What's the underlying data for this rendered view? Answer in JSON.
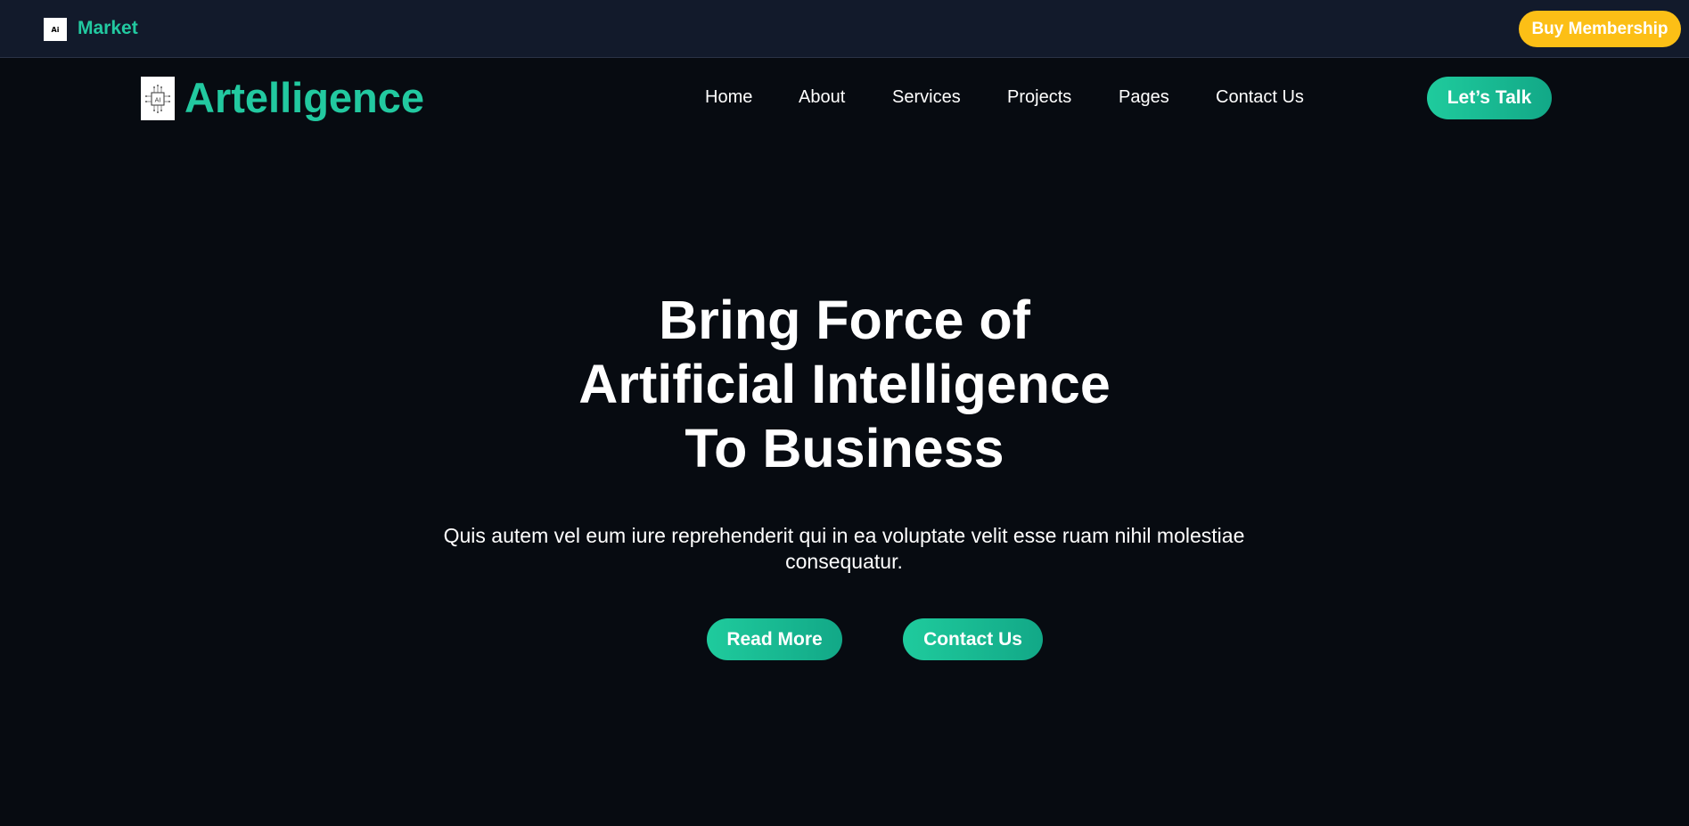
{
  "topbar": {
    "logo_text": "Ai",
    "market_label": "Market",
    "buy_label": "Buy Membership"
  },
  "brand": {
    "icon": "ai-chip-icon",
    "name": "Artelligence"
  },
  "nav": {
    "items": [
      {
        "label": "Home"
      },
      {
        "label": "About"
      },
      {
        "label": "Services"
      },
      {
        "label": "Projects"
      },
      {
        "label": "Pages"
      },
      {
        "label": "Contact Us"
      }
    ],
    "cta_label": "Let’s Talk"
  },
  "hero": {
    "title_lines": [
      "Bring Force of",
      "Artificial Intelligence",
      "To Business"
    ],
    "subtitle": "Quis autem vel eum iure reprehenderit qui in ea voluptate velit esse ruam nihil molestiae consequatur.",
    "primary_label": "Read More",
    "secondary_label": "Contact Us"
  },
  "colors": {
    "page_bg": "#070b11",
    "topbar_bg": "#121a2b",
    "accent": "#22c9a0",
    "membership": "#fcbf16"
  }
}
